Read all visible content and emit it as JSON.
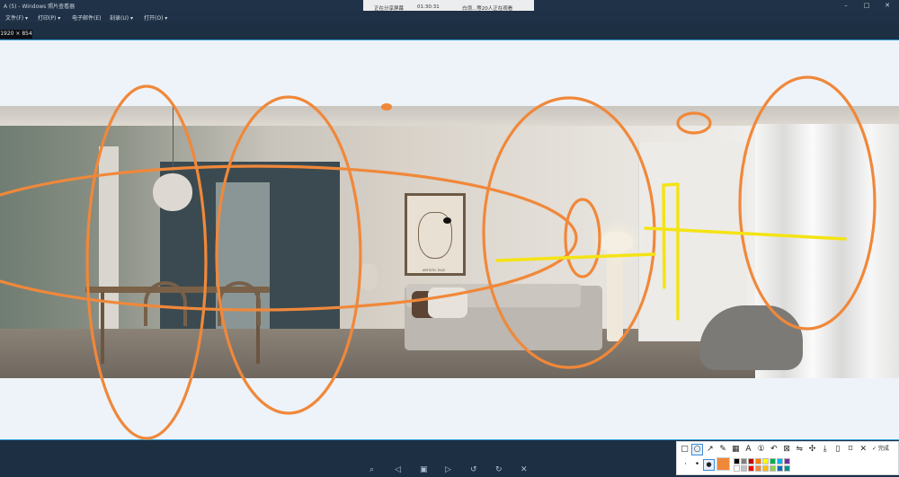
{
  "window": {
    "title": "A (5) - Windows 照片查看器",
    "controls": [
      "–",
      "□",
      "✕"
    ]
  },
  "share_banner": {
    "status": "正在分享屏幕",
    "timer": "01:30:31",
    "viewers": "白须...等20人正在观看"
  },
  "menu": {
    "items": [
      "文件(F) ▾",
      "打印(P) ▾",
      "电子邮件(E)",
      "刻录(U) ▾",
      "打开(O) ▾"
    ]
  },
  "capture": {
    "dimensions": "1920 × 854"
  },
  "artwork_caption": "ARTISTIC FACE",
  "annotation_colors": {
    "ellipse": "#f0883a",
    "highlighter": "#f4e313"
  },
  "toolbar": {
    "tools": [
      {
        "name": "rectangle-tool",
        "glyph": "□"
      },
      {
        "name": "ellipse-tool",
        "glyph": "○",
        "active": true
      },
      {
        "name": "arrow-tool",
        "glyph": "↗"
      },
      {
        "name": "pen-tool",
        "glyph": "✎"
      },
      {
        "name": "mosaic-tool",
        "glyph": "▦"
      },
      {
        "name": "text-tool",
        "glyph": "A"
      },
      {
        "name": "number-tool",
        "glyph": "①"
      },
      {
        "name": "undo-tool",
        "glyph": "↶"
      },
      {
        "name": "pin-tool",
        "glyph": "⊠"
      },
      {
        "name": "translate-tool",
        "glyph": "⇋"
      },
      {
        "name": "eyedropper-tool",
        "glyph": "✣"
      },
      {
        "name": "download-tool",
        "glyph": "⤓"
      },
      {
        "name": "phone-tool",
        "glyph": "▯"
      },
      {
        "name": "bookmark-tool",
        "glyph": "⌑"
      },
      {
        "name": "close-tool",
        "glyph": "✕"
      }
    ],
    "done_label": "✓ 完成",
    "selected_color": "#f0883a",
    "palette": [
      "#000000",
      "#808080",
      "#c00000",
      "#ff7f00",
      "#ffff00",
      "#00b050",
      "#00b0f0",
      "#7030a0",
      "#ffffff",
      "#c0c0c0",
      "#ff0000",
      "#f0883a",
      "#ffc000",
      "#92d050",
      "#0070c0",
      "#009090"
    ]
  },
  "bottom_controls": [
    "⌕",
    "◁",
    "▣",
    "▷",
    "↺",
    "↻",
    "✕"
  ]
}
